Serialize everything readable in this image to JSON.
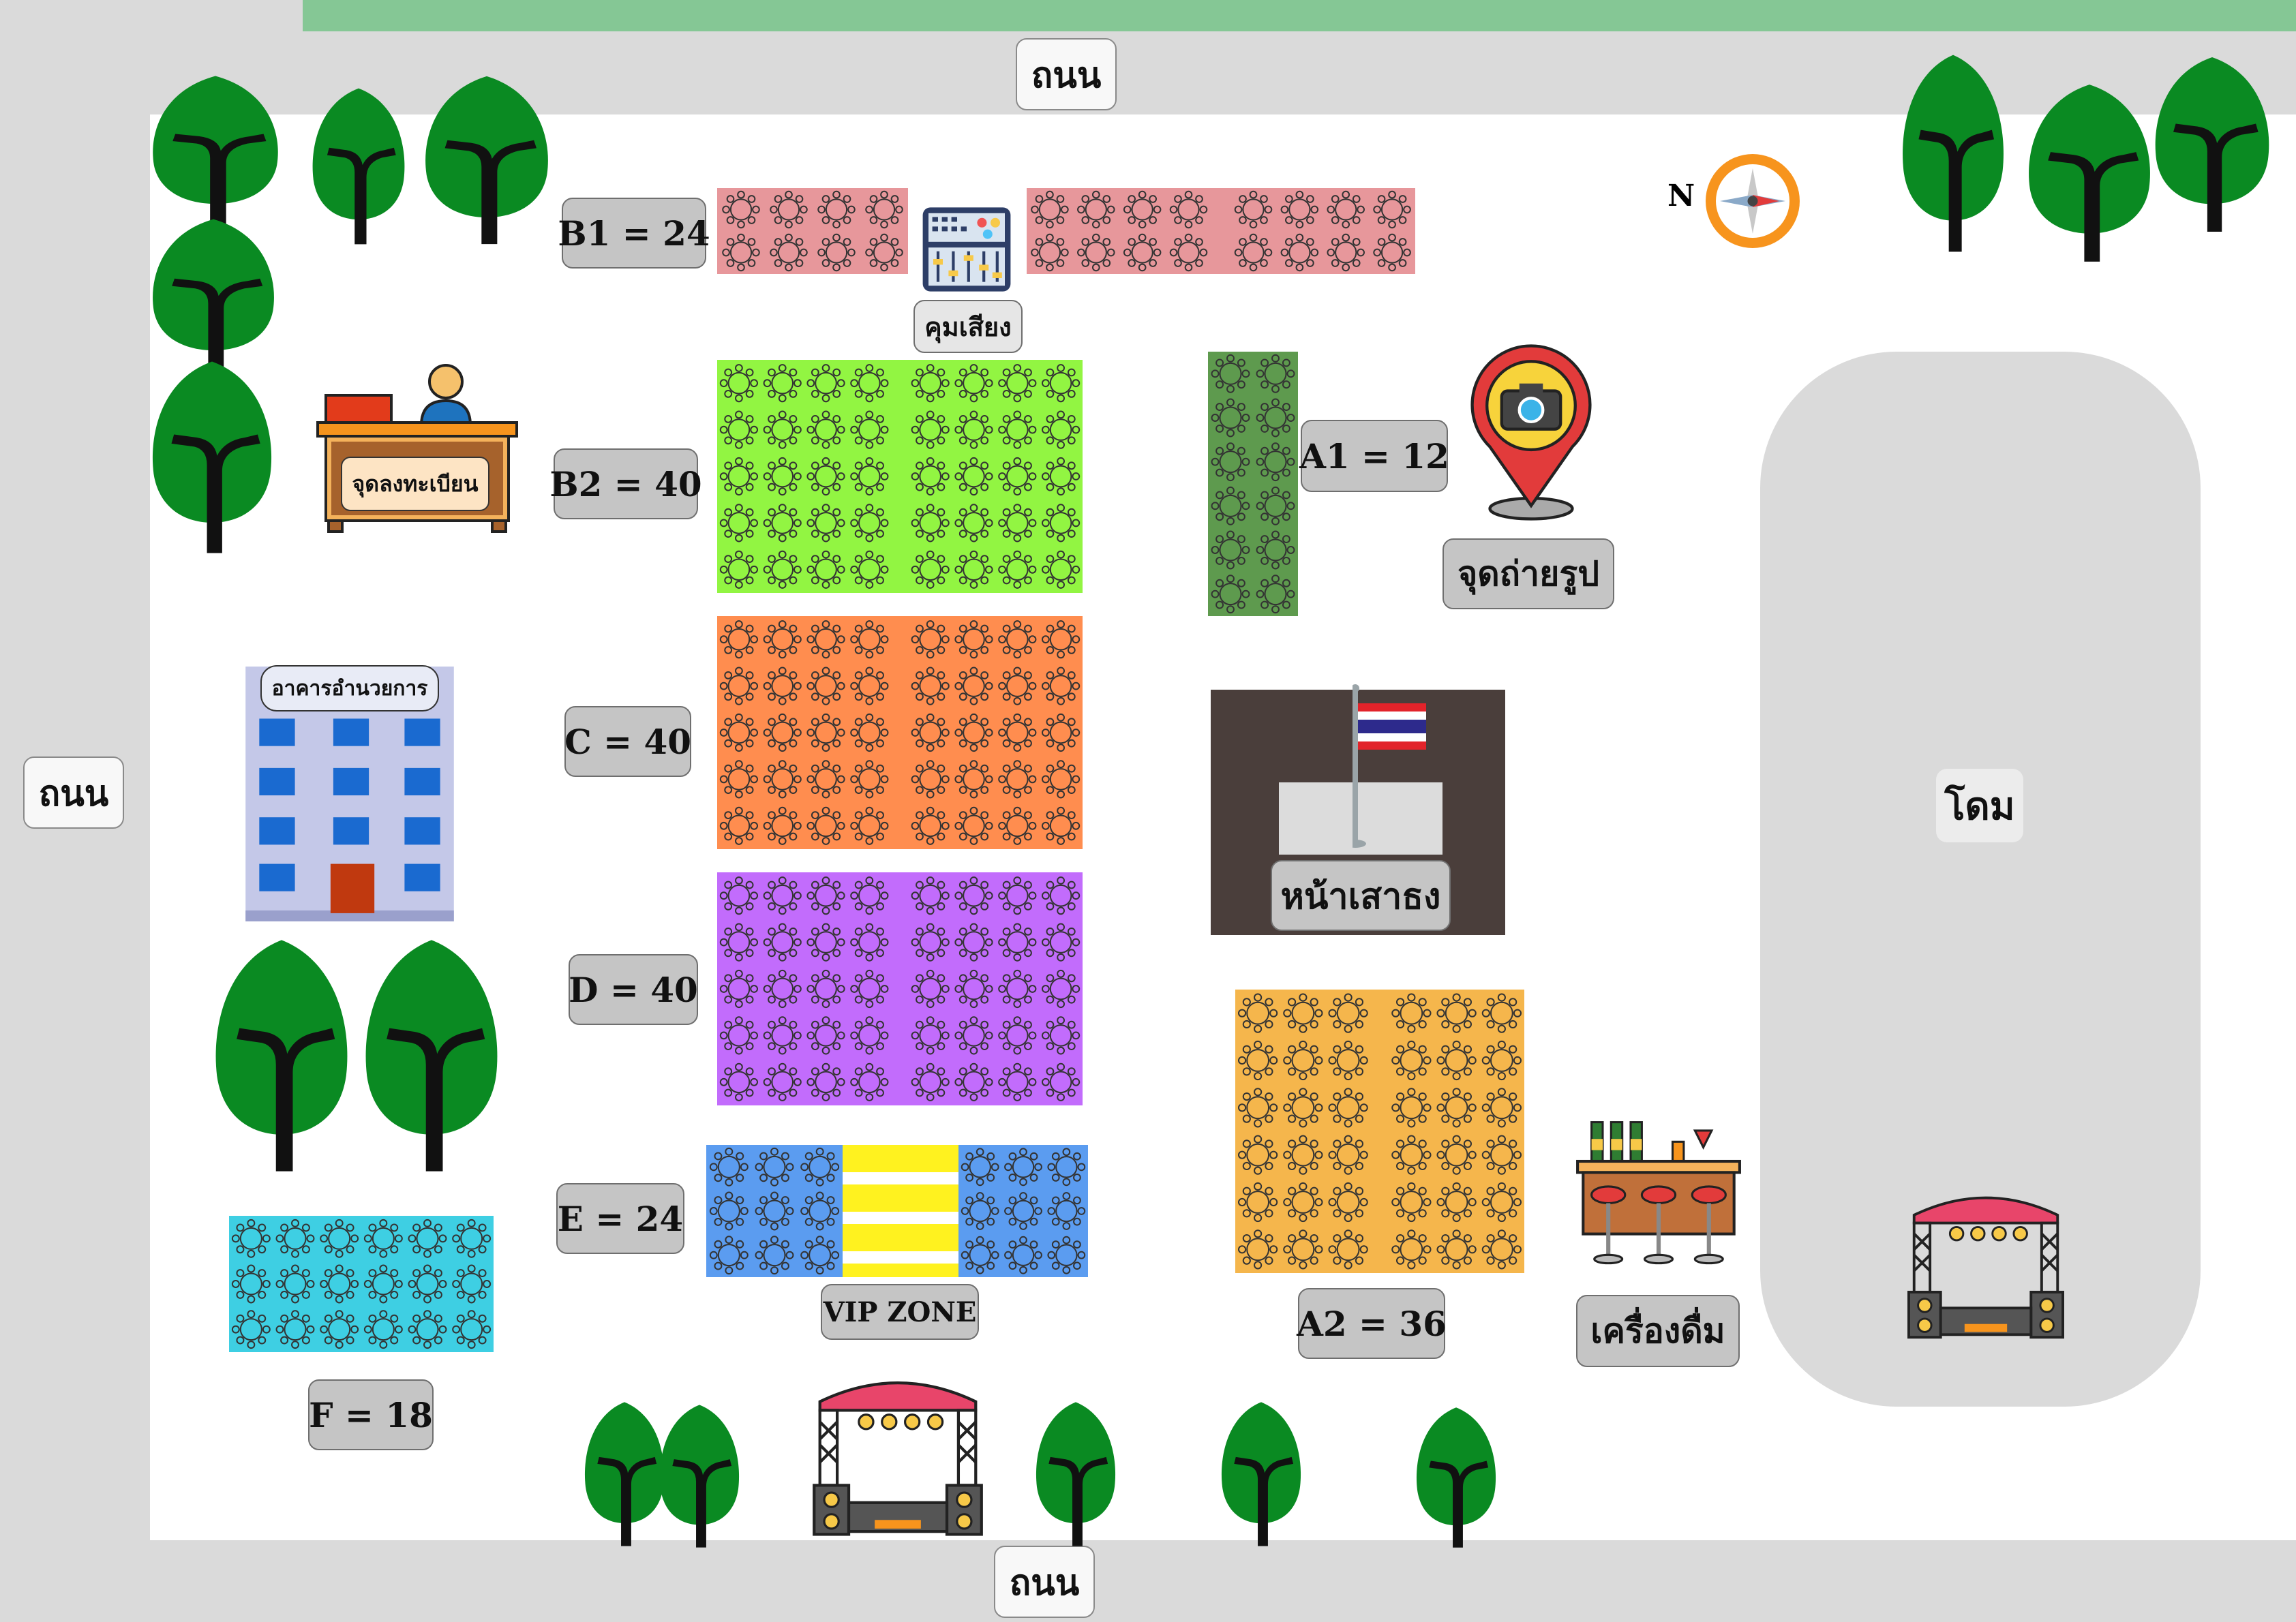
{
  "roads": {
    "top": "ถนน",
    "left": "ถนน",
    "bottom": "ถนน"
  },
  "compass": {
    "north_letter": "N",
    "icon": "compass-icon"
  },
  "zones": [
    {
      "id": "b1",
      "label": "B1 = 24",
      "seats": 24,
      "color": "#e7979b"
    },
    {
      "id": "b2",
      "label": "B2 = 40",
      "seats": 40,
      "color": "#92f542"
    },
    {
      "id": "c",
      "label": "C = 40",
      "seats": 40,
      "color": "#ff8d4f"
    },
    {
      "id": "d",
      "label": "D = 40",
      "seats": 40,
      "color": "#c26cfc"
    },
    {
      "id": "e",
      "label": "E = 24",
      "seats": 24,
      "color": "#5b9cf0"
    },
    {
      "id": "f",
      "label": "F = 18",
      "seats": 18,
      "color": "#3ecfe3"
    },
    {
      "id": "a1",
      "label": "A1 = 12",
      "seats": 12,
      "color": "#5e9a4e"
    },
    {
      "id": "a2",
      "label": "A2 = 36",
      "seats": 36,
      "color": "#f5b64c"
    }
  ],
  "places": {
    "sound_control": "คุมเสียง",
    "registration": "จุดลงทะเบียน",
    "admin_building": "อาคารอำนวยการ",
    "photo_spot": "จุดถ่ายรูป",
    "flagpole": "หน้าเสาธง",
    "vip_zone": "VIP ZONE",
    "drinks": "เครื่องดื่ม",
    "dome": "โดม"
  },
  "colors": {
    "tree": "#0a8a22",
    "trunk": "#111111",
    "label_bg": "#c5c5c5",
    "road": "#dadada",
    "top_strip": "#85c795",
    "flag_area": "#4a3e3b",
    "vip_stripe": "#fff21f"
  }
}
